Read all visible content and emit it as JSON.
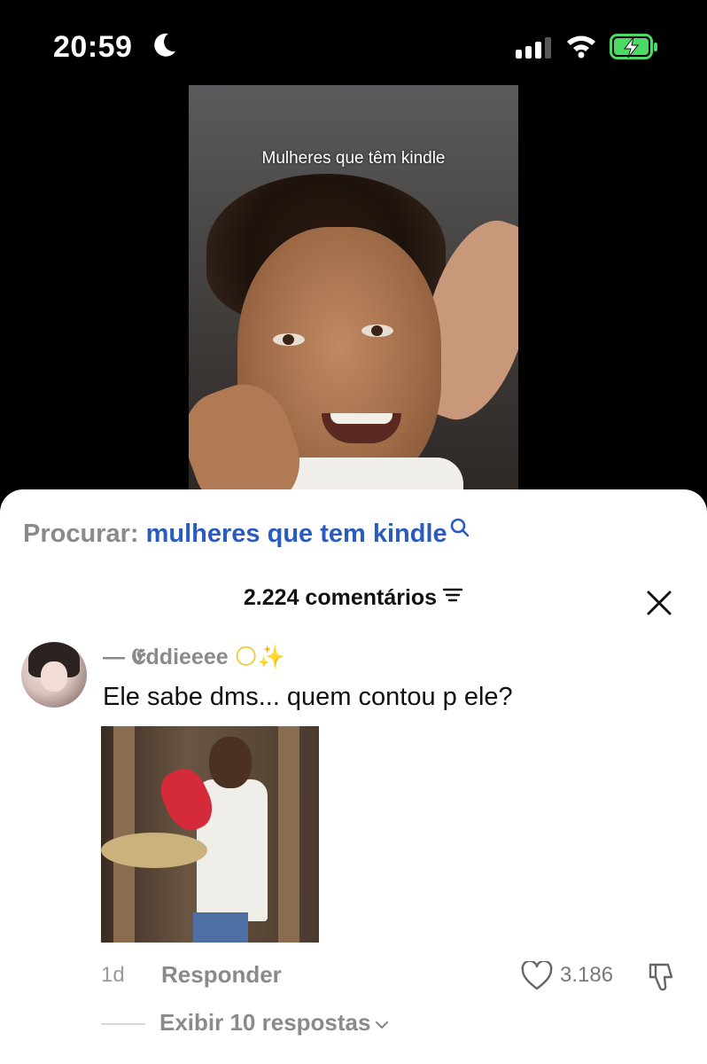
{
  "status_bar": {
    "time": "20:59",
    "moon_icon": "moon-icon",
    "signal_icon": "cellular-signal-icon",
    "wifi_icon": "wifi-icon",
    "battery_icon": "battery-charging-icon",
    "battery_color": "#4cd964"
  },
  "video": {
    "caption": "Mulheres que têm kindle"
  },
  "search": {
    "label": "Procurar:",
    "term": "mulheres que tem kindle",
    "icon": "search-icon",
    "term_color": "#2b5bbf"
  },
  "comments": {
    "count_label": "2.224 comentários",
    "filter_icon": "filter-icon",
    "close_icon": "close-icon"
  },
  "comment": {
    "username": "— 𝕰ddieeee",
    "username_emoji": "🌕✨",
    "text": "Ele sabe dms... quem contou p ele?",
    "age": "1d",
    "reply_label": "Responder",
    "like_count": "3.186",
    "like_icon": "heart-icon",
    "dislike_icon": "thumbs-down-icon",
    "view_replies_label": "Exibir 10 respostas",
    "chevron_icon": "chevron-down-icon"
  }
}
